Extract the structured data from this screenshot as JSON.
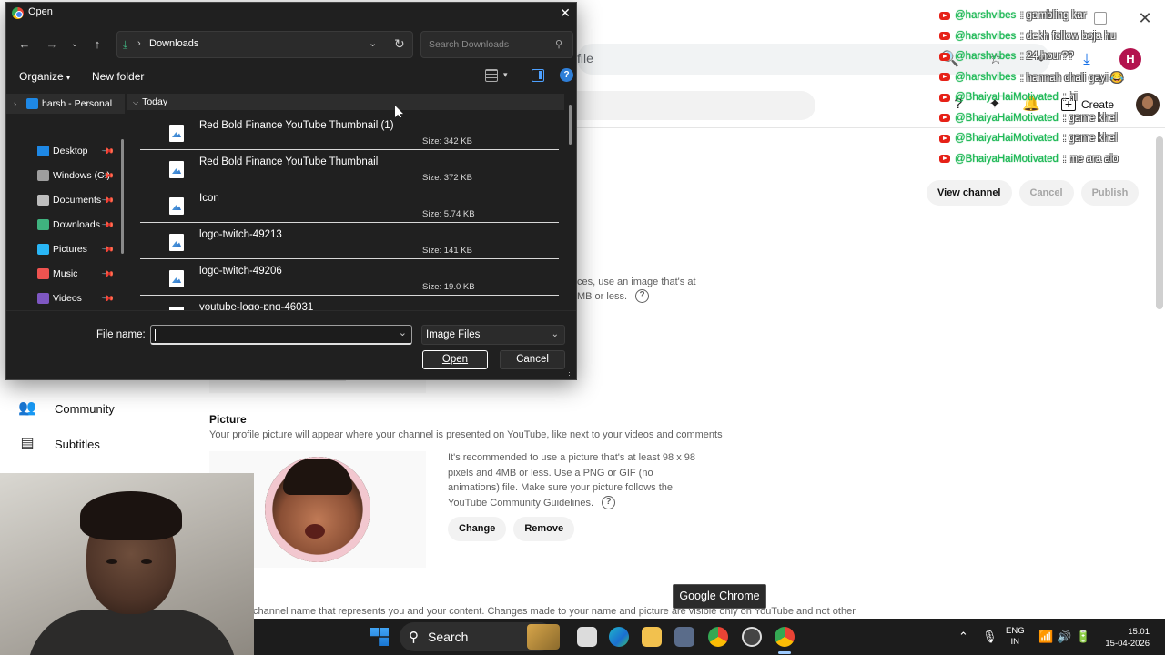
{
  "dialog": {
    "title": "Open",
    "path_folder": "Downloads",
    "search_placeholder": "Search Downloads",
    "toolbar": {
      "organize": "Organize",
      "new_folder": "New folder"
    },
    "sidebar": [
      {
        "label": "harsh - Personal",
        "icon": "cloud-icon",
        "color": "#1e88e5"
      },
      {
        "label": "Desktop",
        "icon": "desktop-icon",
        "color": "#1e88e5"
      },
      {
        "label": "Windows (C:)",
        "icon": "drive-icon",
        "color": "#9e9e9e"
      },
      {
        "label": "Documents",
        "icon": "documents-icon",
        "color": "#bdbdbd"
      },
      {
        "label": "Downloads",
        "icon": "downloads-icon",
        "color": "#3fb37f"
      },
      {
        "label": "Pictures",
        "icon": "pictures-icon",
        "color": "#29b6f6"
      },
      {
        "label": "Music",
        "icon": "music-icon",
        "color": "#ef5350"
      },
      {
        "label": "Videos",
        "icon": "videos-icon",
        "color": "#7e57c2"
      }
    ],
    "group_header": "Today",
    "files": [
      {
        "name": "Red Bold Finance YouTube Thumbnail (1)",
        "size": "Size: 342 KB"
      },
      {
        "name": "Red Bold Finance YouTube Thumbnail",
        "size": "Size: 372 KB"
      },
      {
        "name": "Icon",
        "size": "Size: 5.74 KB"
      },
      {
        "name": "logo-twitch-49213",
        "size": "Size: 141 KB"
      },
      {
        "name": "logo-twitch-49206",
        "size": "Size: 19.0 KB"
      },
      {
        "name": "youtube-logo-png-46031",
        "size": ""
      }
    ],
    "file_name_label": "File name:",
    "file_name_value": "",
    "file_type": "Image Files",
    "open_button": "Open",
    "cancel_button": "Cancel"
  },
  "browser": {
    "address_partial": "file"
  },
  "studio": {
    "create_label": "Create",
    "actions": {
      "view_channel": "View channel",
      "cancel": "Cancel",
      "publish": "Publish"
    },
    "banner_text": "ces, use an image that's at",
    "banner_text2": "MB or less.",
    "nav": [
      {
        "label": "Community",
        "icon": "community-icon"
      },
      {
        "label": "Subtitles",
        "icon": "subtitles-icon"
      }
    ],
    "picture": {
      "title": "Picture",
      "description": "Your profile picture will appear where your channel is presented on YouTube, like next to your videos and comments",
      "recommendation": "It's recommended to use a picture that's at least 98 x 98 pixels and 4MB or less. Use a PNG or GIF (no animations) file. Make sure your picture follows the YouTube Community Guidelines.",
      "change": "Change",
      "remove": "Remove"
    },
    "name_description": "channel name that represents you and your content. Changes made to your name and picture are visible only on YouTube and not other"
  },
  "chat": [
    {
      "user": "@harshvibes",
      "message": ": gambling kar"
    },
    {
      "user": "@harshvibes",
      "message": ": dekh follow boja hu"
    },
    {
      "user": "@harshvibes",
      "message": ": 24 hour??"
    },
    {
      "user": "@harshvibes",
      "message": ": hannah chali gayi 😂"
    },
    {
      "user": "@BhaiyaHaiMotivated",
      "message": ": hi"
    },
    {
      "user": "@BhaiyaHaiMotivated",
      "message": ": game khel"
    },
    {
      "user": "@BhaiyaHaiMotivated",
      "message": ": game khel"
    },
    {
      "user": "@BhaiyaHaiMotivated",
      "message": ": me ara alo"
    }
  ],
  "tooltip": "Google Chrome",
  "taskbar": {
    "search": "Search",
    "lang1": "ENG",
    "lang2": "IN",
    "time": "15:01",
    "date": "15-04-2026"
  }
}
